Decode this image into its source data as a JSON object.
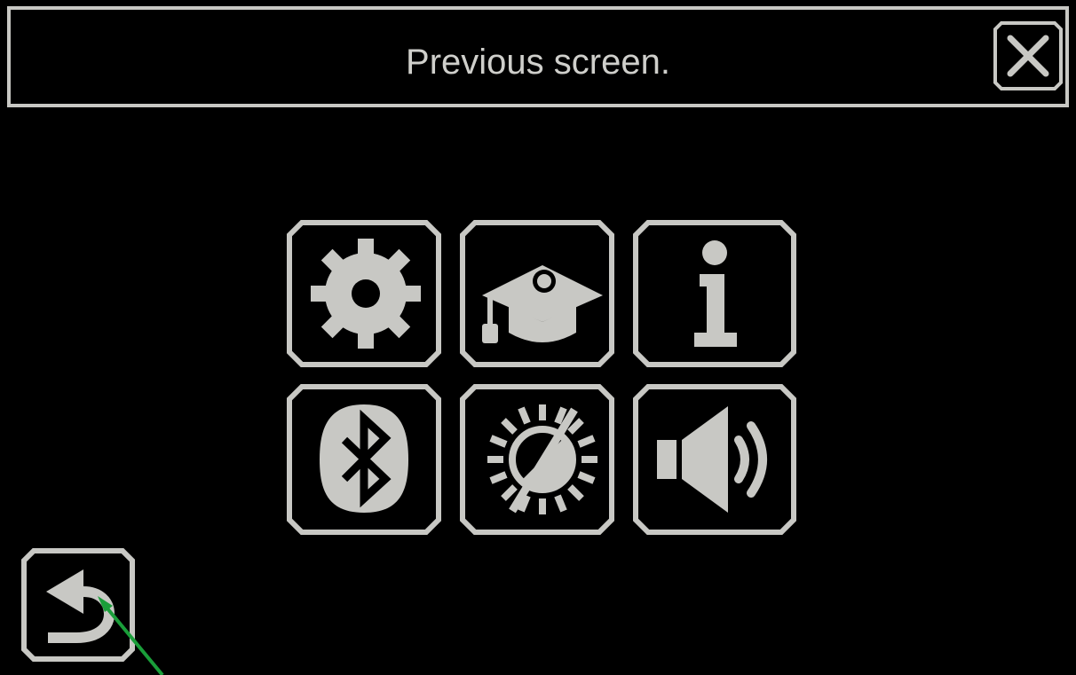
{
  "header": {
    "title": "Previous screen."
  },
  "menu": {
    "tiles": [
      {
        "icon": "gear-icon"
      },
      {
        "icon": "graduation-cap-icon"
      },
      {
        "icon": "info-icon"
      },
      {
        "icon": "bluetooth-icon"
      },
      {
        "icon": "brightness-icon"
      },
      {
        "icon": "speaker-volume-icon"
      }
    ]
  },
  "colors": {
    "background": "#000000",
    "foreground": "#c8c8c4",
    "annotation_arrow": "#1a9e3a"
  },
  "icons": {
    "close": "close-icon",
    "back": "back-arrow-icon"
  }
}
